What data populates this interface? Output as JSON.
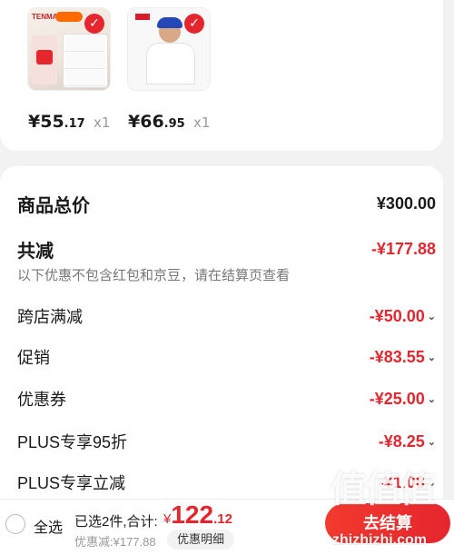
{
  "products": [
    {
      "brand": "TENMA",
      "price_int": "¥55",
      "price_dec": ".17",
      "qty": "x1"
    },
    {
      "price_int": "¥66",
      "price_dec": ".95",
      "qty": "x1"
    }
  ],
  "summary": {
    "total_label": "商品总价",
    "total_value": "¥300.00",
    "reduce_label": "共减",
    "reduce_value": "-¥177.88",
    "note": "以下优惠不包含红包和京豆，请在结算页查看",
    "items": [
      {
        "label": "跨店满减",
        "value": "-¥50.00"
      },
      {
        "label": "促销",
        "value": "-¥83.55"
      },
      {
        "label": "优惠券",
        "value": "-¥25.00"
      },
      {
        "label": "PLUS专享95折",
        "value": "-¥8.25"
      },
      {
        "label": "PLUS专享立减",
        "value": "-¥1.08"
      }
    ]
  },
  "bottom_bar": {
    "select_all": "全选",
    "selected_text": "已选2件,合计:",
    "total_yen": "¥",
    "total_int": "122",
    "total_dec": ".12",
    "saved_text": "优惠减:¥177.88",
    "detail_button": "优惠明细",
    "checkout_button": "去结算"
  },
  "watermark": {
    "logo": "值值值",
    "site": "zhizhizhi.com"
  },
  "colors": {
    "accent_red": "#e6262e",
    "background": "#f2f2f2"
  }
}
